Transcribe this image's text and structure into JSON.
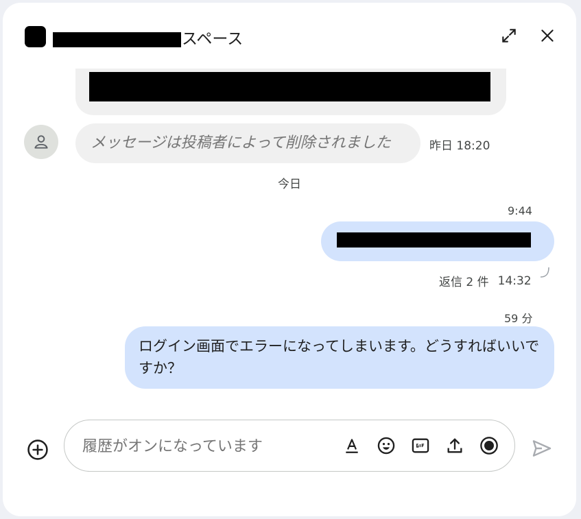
{
  "header": {
    "title_suffix": "スペース",
    "expand_icon": "open-in-full-icon",
    "close_icon": "close-icon"
  },
  "messages": {
    "deleted": {
      "text": "メッセージは投稿者によって削除されました",
      "time": "昨日 18:20"
    },
    "date_divider": "今日",
    "outgoing": [
      {
        "time": "9:44",
        "thread_replies": "返信 2 件",
        "thread_time": "14:32"
      },
      {
        "time": "59 分",
        "text": "ログイン画面でエラーになってしまいます。どうすればいいですか？"
      }
    ]
  },
  "composer": {
    "placeholder": "履歴がオンになっています",
    "tools": [
      "format-text-icon",
      "emoji-icon",
      "gif-icon",
      "upload-icon",
      "record-video-icon"
    ],
    "add_icon": "add-circle-icon",
    "send_icon": "send-icon"
  },
  "colors": {
    "outgoing_bubble": "#d3e3fd",
    "neutral_bubble": "#f0f0f0",
    "muted_text": "#444746"
  }
}
